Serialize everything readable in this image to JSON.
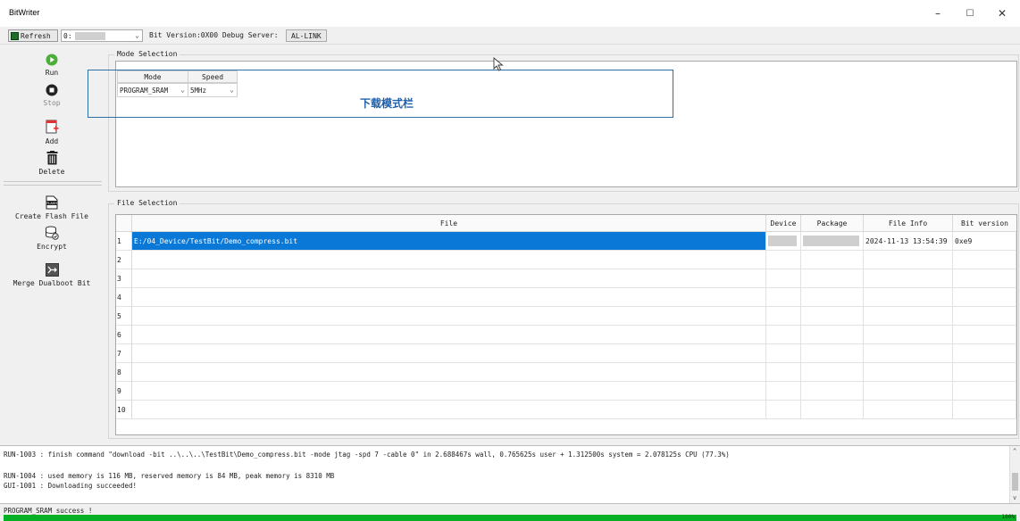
{
  "window": {
    "title": "BitWriter",
    "minimize": "–",
    "maximize": "☐",
    "close": "✕"
  },
  "toolbar": {
    "refresh_label": "Refresh",
    "port_value": "0:",
    "bit_version": "Bit Version:0X00",
    "debug_server_label": "Debug Server:",
    "debug_server_value": "AL-LINK"
  },
  "sidebar": {
    "run": "Run",
    "stop": "Stop",
    "add": "Add",
    "delete": "Delete",
    "create_flash": "Create Flash File",
    "encrypt": "Encrypt",
    "merge": "Merge Dualboot Bit",
    "flash_icon_text": "FLASH"
  },
  "mode_selection": {
    "title": "Mode Selection",
    "headers": [
      "Mode",
      "Speed"
    ],
    "mode_value": "PROGRAM_SRAM",
    "speed_value": "5MHz",
    "annotation": "下载模式栏"
  },
  "file_selection": {
    "title": "File Selection",
    "headers": [
      "File",
      "Device",
      "Package",
      "File Info",
      "Bit version"
    ],
    "rows": [
      {
        "num": "1",
        "file": "E:/04_Device/TestBit/Demo_compress.bit",
        "info": "2024-11-13 13:54:39",
        "bitver": "0xe9"
      },
      {
        "num": "2",
        "file": "",
        "info": "",
        "bitver": ""
      },
      {
        "num": "3",
        "file": "",
        "info": "",
        "bitver": ""
      },
      {
        "num": "4",
        "file": "",
        "info": "",
        "bitver": ""
      },
      {
        "num": "5",
        "file": "",
        "info": "",
        "bitver": ""
      },
      {
        "num": "6",
        "file": "",
        "info": "",
        "bitver": ""
      },
      {
        "num": "7",
        "file": "",
        "info": "",
        "bitver": ""
      },
      {
        "num": "8",
        "file": "",
        "info": "",
        "bitver": ""
      },
      {
        "num": "9",
        "file": "",
        "info": "",
        "bitver": ""
      },
      {
        "num": "10",
        "file": "",
        "info": "",
        "bitver": ""
      }
    ]
  },
  "log": {
    "lines": [
      "RUN-1003 : finish command \"download -bit ..\\..\\..\\TestBit\\Demo_compress.bit -mode jtag -spd 7 -cable 0\" in  2.688467s wall, 0.765625s user + 1.312500s system = 2.078125s CPU (77.3%)",
      "RUN-1004 : used memory is 116 MB, reserved memory is 84 MB, peak memory is 8310 MB",
      "GUI-1001 : Downloading succeeded!"
    ]
  },
  "status": {
    "text": "PROGRAM_SRAM success !",
    "progress_percent": 100,
    "progress_label": "100%"
  },
  "colors": {
    "selection": "#0a78d7",
    "progress": "#06b025",
    "annotation": "#1f5fa8"
  }
}
